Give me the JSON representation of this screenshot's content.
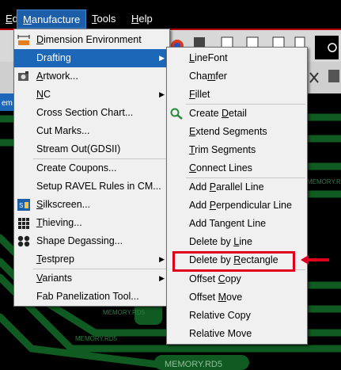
{
  "menubar": {
    "items": [
      {
        "pre": "",
        "ul": "E",
        "post": "dit"
      },
      {
        "pre": "",
        "ul": "M",
        "post": "anufacture"
      },
      {
        "pre": "",
        "ul": "T",
        "post": "ools"
      },
      {
        "pre": "",
        "ul": "H",
        "post": "elp"
      }
    ],
    "active_index": 1
  },
  "manufacture_menu": {
    "items": [
      {
        "pre": "",
        "ul": "D",
        "post": "imension Environment",
        "icon": "dimension-icon"
      },
      {
        "pre": "Drafting",
        "ul": "",
        "post": "",
        "submenu": true,
        "highlighted": true
      },
      {
        "pre": "",
        "ul": "A",
        "post": "rtwork...",
        "icon": "artwork-icon"
      },
      {
        "pre": "",
        "ul": "N",
        "post": "C",
        "submenu": true
      },
      {
        "pre": "Cross Section Chart...",
        "ul": "",
        "post": ""
      },
      {
        "pre": "Cut Marks...",
        "ul": "",
        "post": ""
      },
      {
        "pre": "Stream Out(GDSII)",
        "ul": "",
        "post": ""
      },
      {
        "pre": "Create Coupons...",
        "ul": "",
        "post": ""
      },
      {
        "pre": "Setup RAVEL Rules in CM...",
        "ul": "",
        "post": ""
      },
      {
        "pre": "",
        "ul": "S",
        "post": "ilkscreen...",
        "icon": "silkscreen-icon"
      },
      {
        "pre": "",
        "ul": "T",
        "post": "hieving...",
        "icon": "thieving-icon"
      },
      {
        "pre": "Shape Degassing...",
        "ul": "",
        "post": "",
        "icon": "degassing-icon"
      },
      {
        "pre": "",
        "ul": "T",
        "post": "estprep",
        "submenu": true
      },
      {
        "pre": "",
        "ul": "V",
        "post": "ariants",
        "submenu": true
      },
      {
        "pre": "Fab Panelization Tool...",
        "ul": "",
        "post": ""
      }
    ]
  },
  "drafting_menu": {
    "items": [
      {
        "pre": "",
        "ul": "L",
        "post": "ineFont"
      },
      {
        "pre": "Cha",
        "ul": "m",
        "post": "fer"
      },
      {
        "pre": "",
        "ul": "F",
        "post": "illet"
      },
      {
        "pre": "Create ",
        "ul": "D",
        "post": "etail",
        "icon": "zoom-detail-icon"
      },
      {
        "pre": "",
        "ul": "E",
        "post": "xtend Segments"
      },
      {
        "pre": "",
        "ul": "T",
        "post": "rim Segments"
      },
      {
        "pre": "",
        "ul": "C",
        "post": "onnect Lines"
      },
      {
        "pre": "Add ",
        "ul": "P",
        "post": "arallel Line"
      },
      {
        "pre": "Add ",
        "ul": "P",
        "post": "erpendicular Line"
      },
      {
        "pre": "Add Tan",
        "ul": "g",
        "post": "ent Line"
      },
      {
        "pre": "Delete by ",
        "ul": "L",
        "post": "ine"
      },
      {
        "pre": "Delete by ",
        "ul": "R",
        "post": "ectangle",
        "callout": true
      },
      {
        "pre": "Offset ",
        "ul": "C",
        "post": "opy"
      },
      {
        "pre": "Offset ",
        "ul": "M",
        "post": "ove"
      },
      {
        "pre": "Relative Copy",
        "ul": "",
        "post": ""
      },
      {
        "pre": "Relative Move",
        "ul": "",
        "post": ""
      }
    ]
  },
  "canvas_labels": [
    "MEMORY.RD5",
    "MEMORY.RD5",
    "MEMORY.RD5",
    "MEMORY.RD5"
  ],
  "tab_fragment": "em",
  "colors": {
    "highlight": "#1c67b7",
    "callout": "#e0001b",
    "trace": "#0f5b22",
    "background": "#000000"
  }
}
